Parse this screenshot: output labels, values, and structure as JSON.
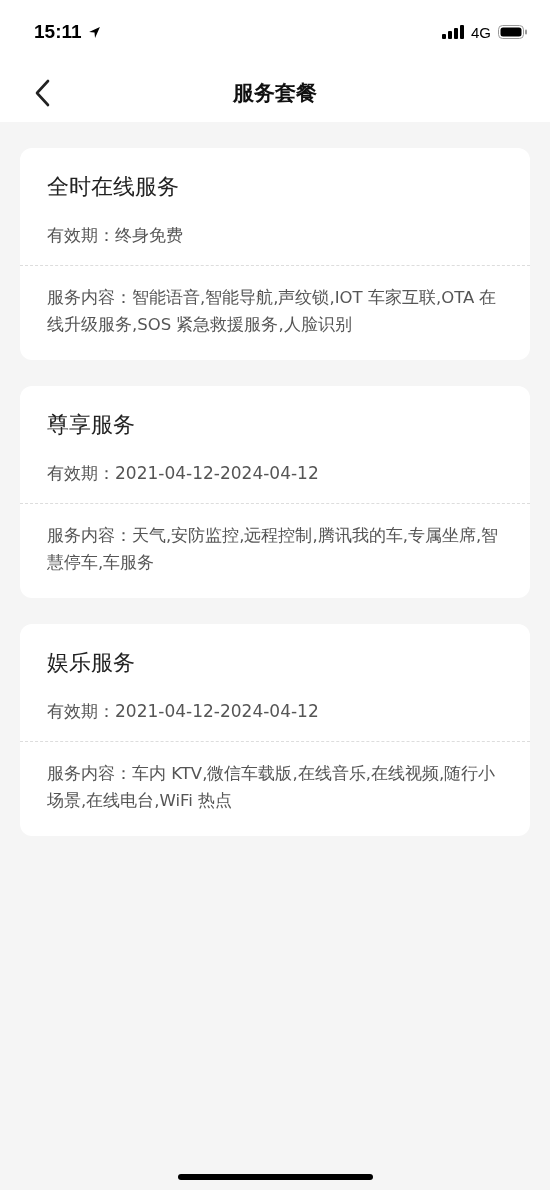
{
  "status_bar": {
    "time": "15:11",
    "network": "4G"
  },
  "nav": {
    "title": "服务套餐"
  },
  "packages": [
    {
      "name": "全时在线服务",
      "validity": "有效期：终身免费",
      "content": "服务内容：智能语音,智能导航,声纹锁,IOT 车家互联,OTA 在线升级服务,SOS 紧急救援服务,人脸识别"
    },
    {
      "name": "尊享服务",
      "validity": "有效期：2021-04-12-2024-04-12",
      "content": "服务内容：天气,安防监控,远程控制,腾讯我的车,专属坐席,智慧停车,车服务"
    },
    {
      "name": "娱乐服务",
      "validity": "有效期：2021-04-12-2024-04-12",
      "content": "服务内容：车内 KTV,微信车载版,在线音乐,在线视频,随行小场景,在线电台,WiFi 热点"
    }
  ]
}
